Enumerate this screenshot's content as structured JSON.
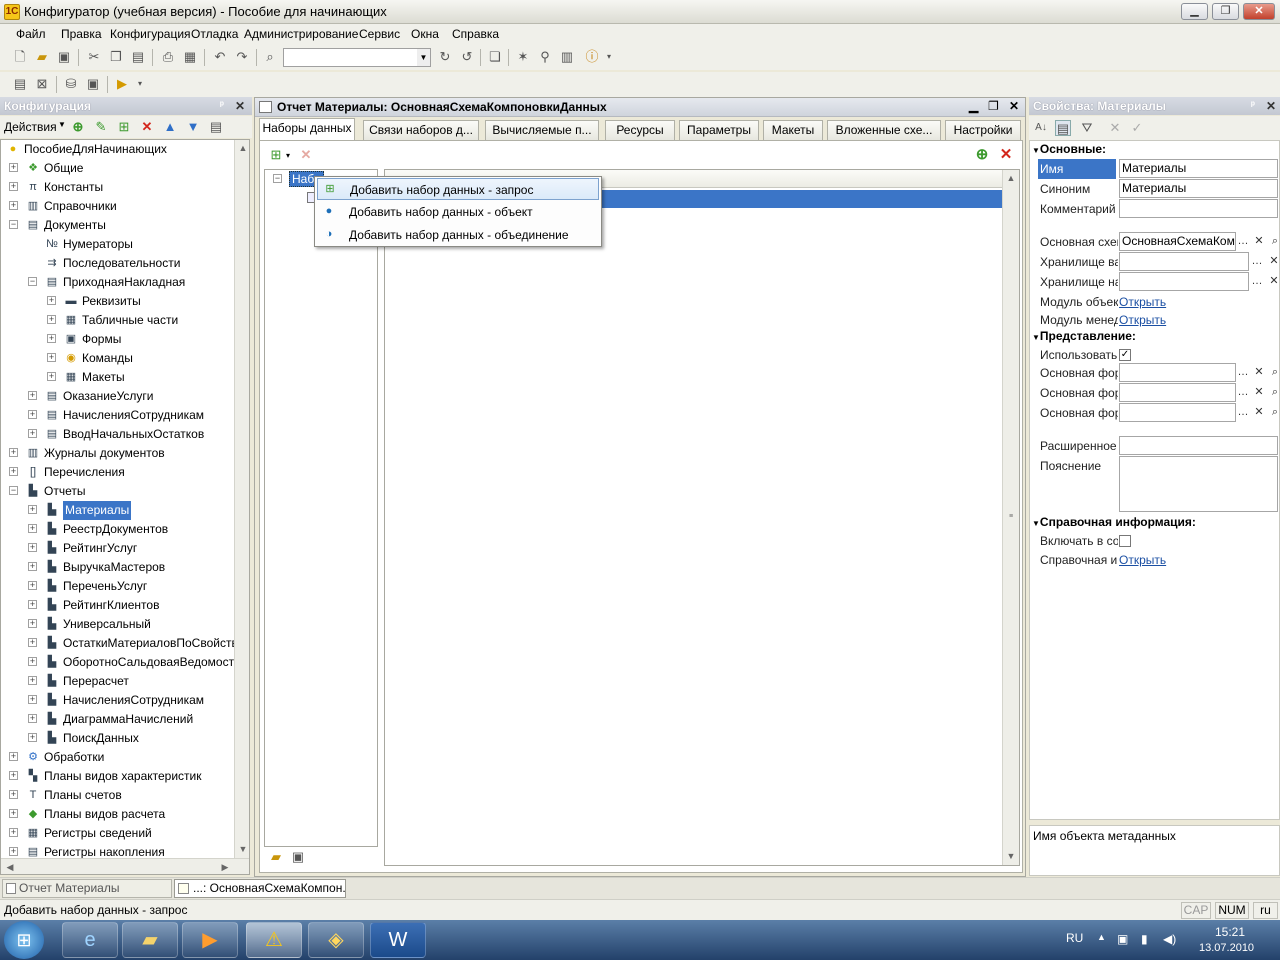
{
  "window": {
    "title": "Конфигуратор (учебная версия) - Пособие для начинающих"
  },
  "menu": [
    "Файл",
    "Правка",
    "Конфигурация",
    "Отладка",
    "Администрирование",
    "Сервис",
    "Окна",
    "Справка"
  ],
  "config_panel": {
    "title": "Конфигурация",
    "actions_label": "Действия",
    "tree": [
      {
        "label": "ПособиеДляНачинающих",
        "icon": "config-root-icon",
        "level": 0
      },
      {
        "label": "Общие",
        "icon": "common-icon",
        "level": 1
      },
      {
        "label": "Константы",
        "icon": "constants-icon",
        "level": 1
      },
      {
        "label": "Справочники",
        "icon": "catalogs-icon",
        "level": 1
      },
      {
        "label": "Документы",
        "icon": "documents-icon",
        "level": 1
      },
      {
        "label": "Нумераторы",
        "icon": "numerators-icon",
        "level": 2
      },
      {
        "label": "Последовательности",
        "icon": "sequences-icon",
        "level": 2
      },
      {
        "label": "ПриходнаяНакладная",
        "icon": "document-icon",
        "level": 2
      },
      {
        "label": "Реквизиты",
        "icon": "attributes-icon",
        "level": 3
      },
      {
        "label": "Табличные части",
        "icon": "tabular-icon",
        "level": 3
      },
      {
        "label": "Формы",
        "icon": "forms-icon",
        "level": 3
      },
      {
        "label": "Команды",
        "icon": "commands-icon",
        "level": 3
      },
      {
        "label": "Макеты",
        "icon": "templates-icon",
        "level": 3
      },
      {
        "label": "ОказаниеУслуги",
        "icon": "document-icon",
        "level": 2
      },
      {
        "label": "НачисленияСотрудникам",
        "icon": "document-icon",
        "level": 2
      },
      {
        "label": "ВводНачальныхОстатков",
        "icon": "document-icon",
        "level": 2
      },
      {
        "label": "Журналы документов",
        "icon": "journals-icon",
        "level": 1
      },
      {
        "label": "Перечисления",
        "icon": "enums-icon",
        "level": 1
      },
      {
        "label": "Отчеты",
        "icon": "reports-icon",
        "level": 1
      },
      {
        "label": "Материалы",
        "icon": "report-icon",
        "level": 2,
        "selected": true
      },
      {
        "label": "РеестрДокументов",
        "icon": "report-icon",
        "level": 2
      },
      {
        "label": "РейтингУслуг",
        "icon": "report-icon",
        "level": 2
      },
      {
        "label": "ВыручкаМастеров",
        "icon": "report-icon",
        "level": 2
      },
      {
        "label": "ПереченьУслуг",
        "icon": "report-icon",
        "level": 2
      },
      {
        "label": "РейтингКлиентов",
        "icon": "report-icon",
        "level": 2
      },
      {
        "label": "Универсальный",
        "icon": "report-icon",
        "level": 2
      },
      {
        "label": "ОстаткиМатериаловПоСвойств...",
        "icon": "report-icon",
        "level": 2
      },
      {
        "label": "ОборотноСальдоваяВедомость",
        "icon": "report-icon",
        "level": 2
      },
      {
        "label": "Перерасчет",
        "icon": "report-icon",
        "level": 2
      },
      {
        "label": "НачисленияСотрудникам",
        "icon": "report-icon",
        "level": 2
      },
      {
        "label": "ДиаграммаНачислений",
        "icon": "report-icon",
        "level": 2
      },
      {
        "label": "ПоискДанных",
        "icon": "report-icon",
        "level": 2
      },
      {
        "label": "Обработки",
        "icon": "processors-icon",
        "level": 1
      },
      {
        "label": "Планы видов характеристик",
        "icon": "chart-types-icon",
        "level": 1
      },
      {
        "label": "Планы счетов",
        "icon": "accounts-icon",
        "level": 1
      },
      {
        "label": "Планы видов расчета",
        "icon": "calc-types-icon",
        "level": 1
      },
      {
        "label": "Регистры сведений",
        "icon": "info-registers-icon",
        "level": 1
      },
      {
        "label": "Регистры накопления",
        "icon": "accum-registers-icon",
        "level": 1
      }
    ]
  },
  "editor": {
    "title": "Отчет Материалы: ОсновнаяСхемаКомпоновкиДанных",
    "tabs": [
      "Наборы данных",
      "Связи наборов д...",
      "Вычисляемые п...",
      "Ресурсы",
      "Параметры",
      "Макеты",
      "Вложенные схе...",
      "Настройки"
    ],
    "active_tab": 0,
    "tree_item": "Набо",
    "grid_header": "",
    "popup": [
      {
        "label": "Добавить набор данных - запрос",
        "icon": "query-dataset-icon"
      },
      {
        "label": "Добавить набор данных - объект",
        "icon": "object-dataset-icon"
      },
      {
        "label": "Добавить набор данных - объединение",
        "icon": "union-dataset-icon"
      }
    ]
  },
  "properties": {
    "title": "Свойства: Материалы",
    "sections": {
      "main": "Основные:",
      "presentation": "Представление:",
      "reference": "Справочная информация:"
    },
    "rows": {
      "name": {
        "label": "Имя",
        "value": "Материалы"
      },
      "synonym": {
        "label": "Синоним",
        "value": "Материалы"
      },
      "comment": {
        "label": "Комментарий",
        "value": ""
      },
      "main_schema": {
        "label": "Основная схем",
        "value": "ОсновнаяСхемаКомп"
      },
      "variants_storage": {
        "label": "Хранилище вар",
        "value": ""
      },
      "settings_storage": {
        "label": "Хранилище нас",
        "value": ""
      },
      "object_module": {
        "label": "Модуль объект",
        "link": "Открыть"
      },
      "manager_module": {
        "label": "Модуль менед:",
        "link": "Открыть"
      },
      "use": {
        "label": "Использовать",
        "checked": true
      },
      "main_form1": {
        "label": "Основная форм",
        "value": ""
      },
      "main_form2": {
        "label": "Основная форм",
        "value": ""
      },
      "main_form3": {
        "label": "Основная форм",
        "value": ""
      },
      "ext_presentation": {
        "label": "Расширенное п",
        "value": ""
      },
      "explanation": {
        "label": "Пояснение",
        "value": ""
      },
      "include_in": {
        "label": "Включать в сод",
        "checked": false
      },
      "reference_info": {
        "label": "Справочная ин",
        "link": "Открыть"
      }
    },
    "hint": "Имя объекта метаданных"
  },
  "window_tabs": [
    "Отчет Материалы",
    "...: ОсновнаяСхемаКомпон..."
  ],
  "status": {
    "text": "Добавить набор данных - запрос",
    "cap": "CAP",
    "num": "NUM",
    "lang": "ru"
  },
  "taskbar": {
    "lang": "RU",
    "time": "15:21",
    "date": "13.07.2010"
  },
  "colors": {
    "selection": "#3b75c7",
    "accent_green": "#3c9a2e",
    "accent_red": "#d3261c"
  }
}
